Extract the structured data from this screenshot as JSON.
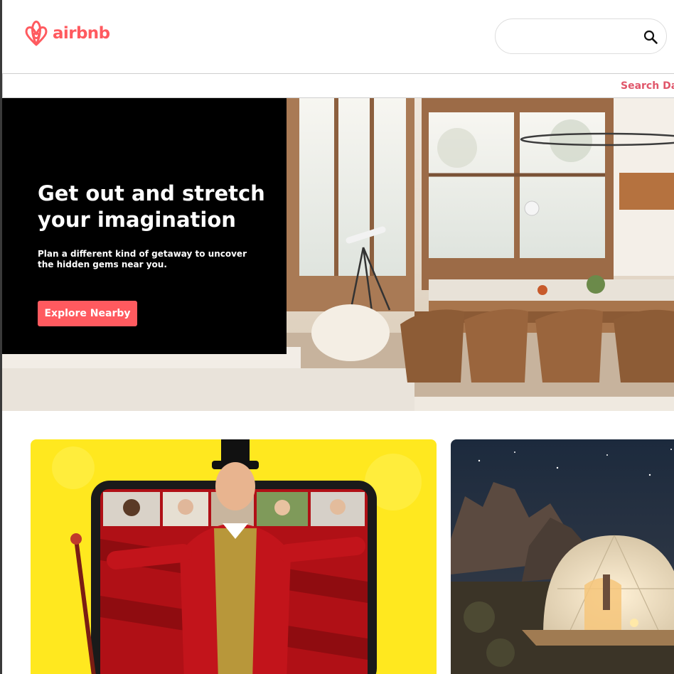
{
  "header": {
    "logo_text": "airbnb",
    "search": {
      "value": "",
      "placeholder": ""
    }
  },
  "subnav": {
    "search_dates_label": "Search Dat"
  },
  "hero": {
    "title": "Get out and stretch your imagination",
    "subtitle": "Plan a different kind of getaway to uncover the hidden gems near you.",
    "button_label": "Explore Nearby"
  },
  "icons": {
    "logo": "airbnb-logo-icon",
    "search": "search-icon"
  },
  "colors": {
    "brand": "#ff5a5f",
    "link": "#e0566a",
    "hero_panel": "#000000",
    "card_yellow": "#ffe81f"
  }
}
